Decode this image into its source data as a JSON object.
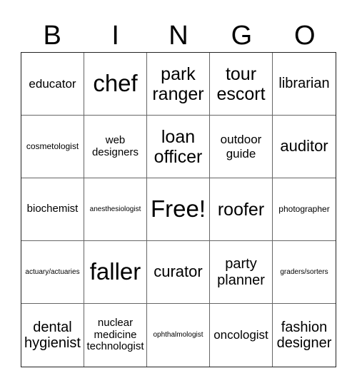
{
  "header": {
    "letters": [
      "B",
      "I",
      "N",
      "G",
      "O"
    ]
  },
  "board": {
    "rows": [
      [
        "educator",
        "chef",
        "park ranger",
        "tour escort",
        "librarian"
      ],
      [
        "cosmetologist",
        "web designers",
        "loan officer",
        "outdoor guide",
        "auditor"
      ],
      [
        "biochemist",
        "anesthesiologist",
        "Free!",
        "roofer",
        "photographer"
      ],
      [
        "actuary/actuaries",
        "faller",
        "curator",
        "party planner",
        "graders/sorters"
      ],
      [
        "dental hygienist",
        "nuclear medicine technologist",
        "ophthalmologist",
        "oncologist",
        "fashion designer"
      ]
    ],
    "free_space": "Free!"
  }
}
